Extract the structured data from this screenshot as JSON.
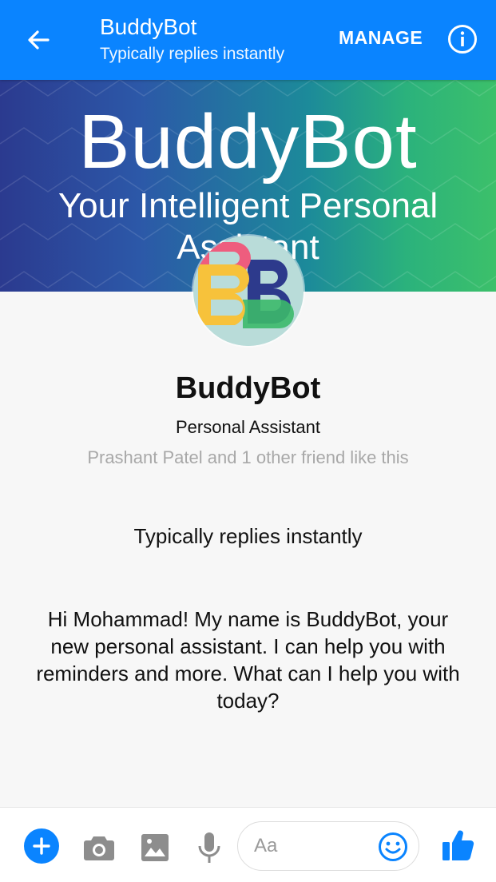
{
  "colors": {
    "primary": "#0a84ff",
    "text": "#111111",
    "muted": "#a8a8a8",
    "background": "#f7f7f7"
  },
  "header": {
    "title": "BuddyBot",
    "subtitle": "Typically replies instantly",
    "manage_label": "MANAGE",
    "icons": [
      "back-arrow-icon",
      "info-icon"
    ]
  },
  "banner": {
    "title": "BuddyBot",
    "subtitle_line1": "Your Intelligent Personal",
    "subtitle_line2": "Assistant"
  },
  "profile": {
    "name": "BuddyBot",
    "category": "Personal Assistant",
    "friends": "Prashant Patel and 1 other friend like this",
    "reply_time": "Typically replies instantly"
  },
  "conversation": {
    "greeting": "Hi Mohammad! My name is BuddyBot, your new personal assistant. I can help you with reminders and more. What can I help you with today?"
  },
  "composer": {
    "placeholder": "Aa",
    "value": "",
    "icons": [
      "plus-icon",
      "camera-icon",
      "image-icon",
      "microphone-icon",
      "emoji-icon",
      "thumbs-up-icon"
    ]
  }
}
